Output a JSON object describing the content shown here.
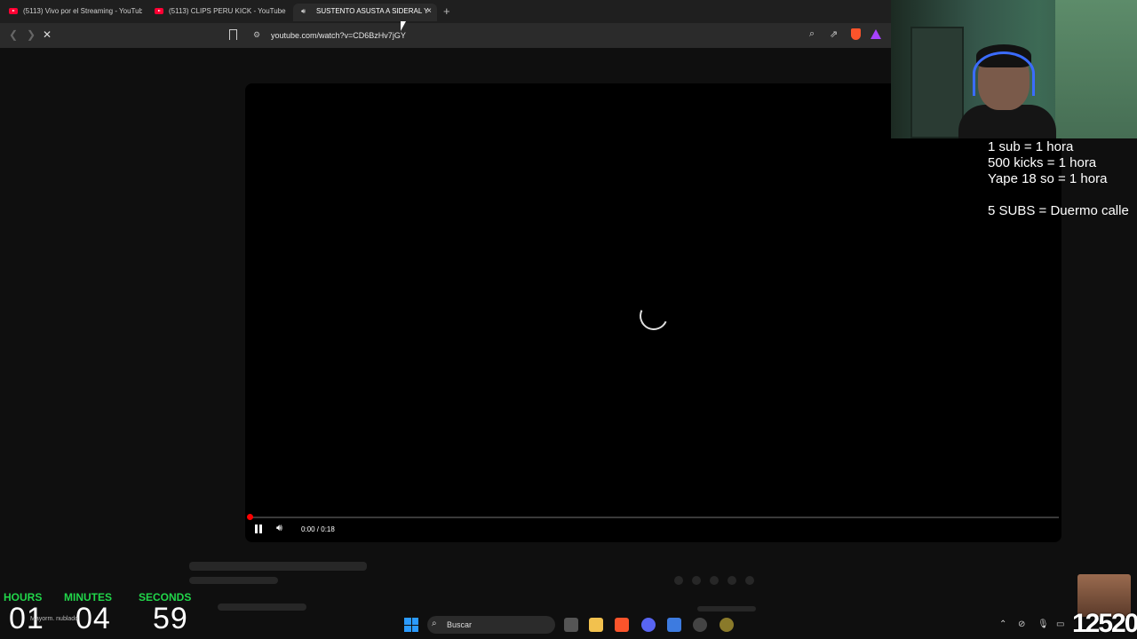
{
  "browser": {
    "tabs": [
      {
        "title": "(5113) Vivo por el Streaming - YouTube",
        "active": false
      },
      {
        "title": "(5113) CLIPS PERU KICK - YouTube",
        "active": false
      },
      {
        "title": "SUSTENTO ASUSTA A SIDERAL Y",
        "active": true
      }
    ],
    "new_tab_label": "+",
    "close_tab_label": "×",
    "url": "youtube.com/watch?v=CD6BzHv7jGY"
  },
  "player": {
    "timecode": "0:00 / 0:18",
    "progress": 0.0
  },
  "overlay": {
    "rules": [
      "1 sub = 1 hora",
      "500 kicks = 1 hora",
      "Yape 18 so = 1 hora",
      "",
      "5 SUBS = Duermo calle"
    ],
    "timer": {
      "hours_label": "HOURS",
      "minutes_label": "MINUTES",
      "seconds_label": "SECONDS",
      "hours": "01",
      "minutes": "04",
      "seconds": "59",
      "label_color": "#21d64a"
    },
    "viewer_count": "12520"
  },
  "taskbar": {
    "weather": "Mayorm. nublado",
    "search_placeholder": "Buscar"
  },
  "icons": {
    "back": "chevron-left-icon",
    "forward": "chevron-right-icon",
    "stop": "close-icon",
    "zoom": "magnifier-icon",
    "share": "share-icon",
    "shield": "brave-shield-icon",
    "rewards": "brave-rewards-icon"
  }
}
